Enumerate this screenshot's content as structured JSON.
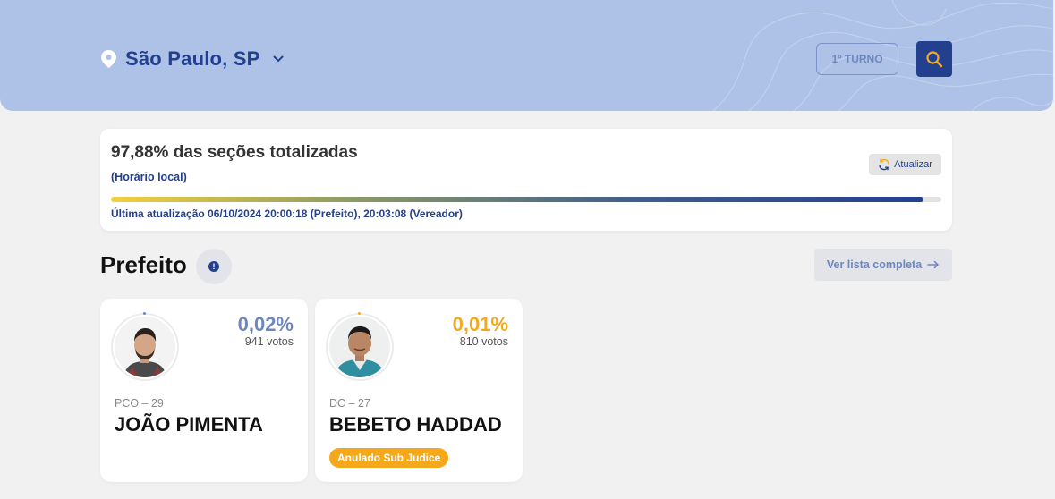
{
  "header": {
    "location": "São Paulo, SP",
    "turno_label": "1º TURNO"
  },
  "status": {
    "title": "97,88% das seções totalizadas",
    "subtitle": "(Horário local)",
    "refresh_label": "Atualizar",
    "progress_percent": 97.88,
    "last_update": "Última atualização 06/10/2024 20:00:18 (Prefeito), 20:03:08 (Vereador)"
  },
  "section": {
    "title": "Prefeito",
    "info_icon": "!",
    "see_full_list_label": "Ver lista completa"
  },
  "candidates": [
    {
      "percent": "0,02%",
      "votes": "941 votos",
      "party": "PCO – 29",
      "name": "JOÃO PIMENTA",
      "accent_color": "#6f87bf",
      "badge": null
    },
    {
      "percent": "0,01%",
      "votes": "810 votos",
      "party": "DC – 27",
      "name": "BEBETO HADDAD",
      "accent_color": "#f6a81b",
      "badge": "Anulado Sub Judice"
    }
  ],
  "colors": {
    "header_bg": "#aec2e8",
    "primary": "#23408e",
    "muted_primary": "#6f87bf",
    "warning": "#f6a81b"
  },
  "icons": {
    "location": "map-pin-icon",
    "dropdown": "chevron-down-icon",
    "search": "search-icon",
    "refresh": "refresh-icon",
    "info": "info-icon",
    "arrow": "arrow-right-icon"
  }
}
